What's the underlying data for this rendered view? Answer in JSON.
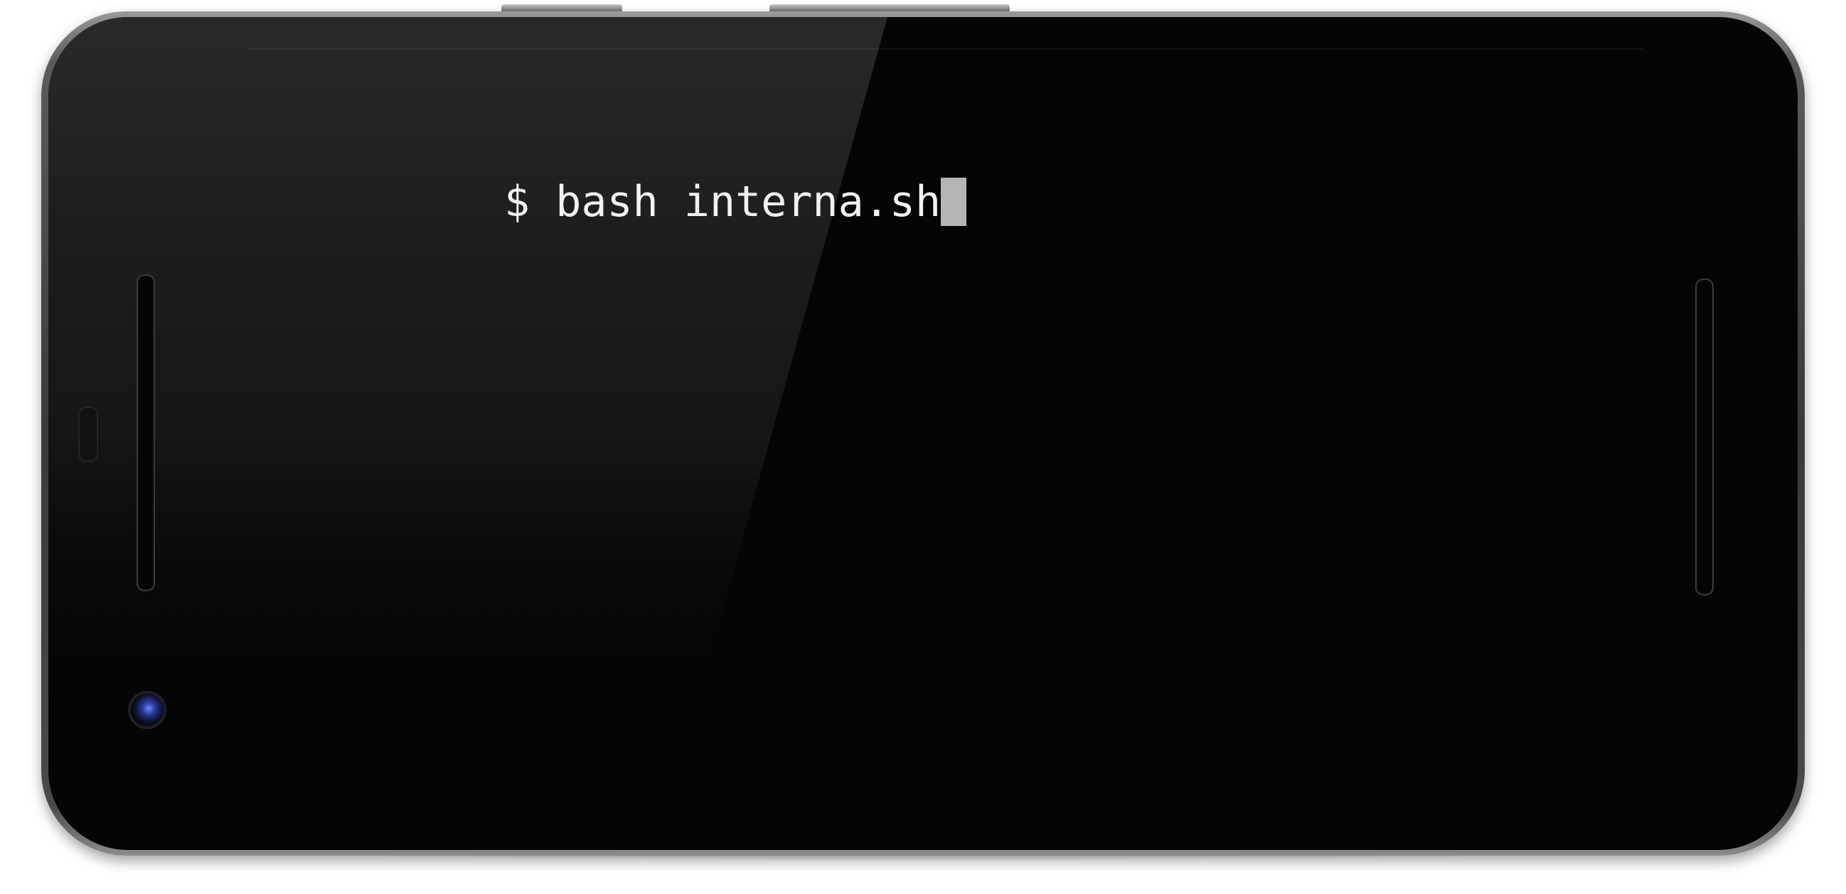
{
  "terminal": {
    "prompt_symbol": "$",
    "command": "bash interna.sh",
    "cursor_color": "#b5b5b5",
    "text_color": "#f2f2f2",
    "background_color": "#000000"
  },
  "device": {
    "camera_icon": "front-camera-icon",
    "speaker_icon": "speaker-grille-icon"
  }
}
